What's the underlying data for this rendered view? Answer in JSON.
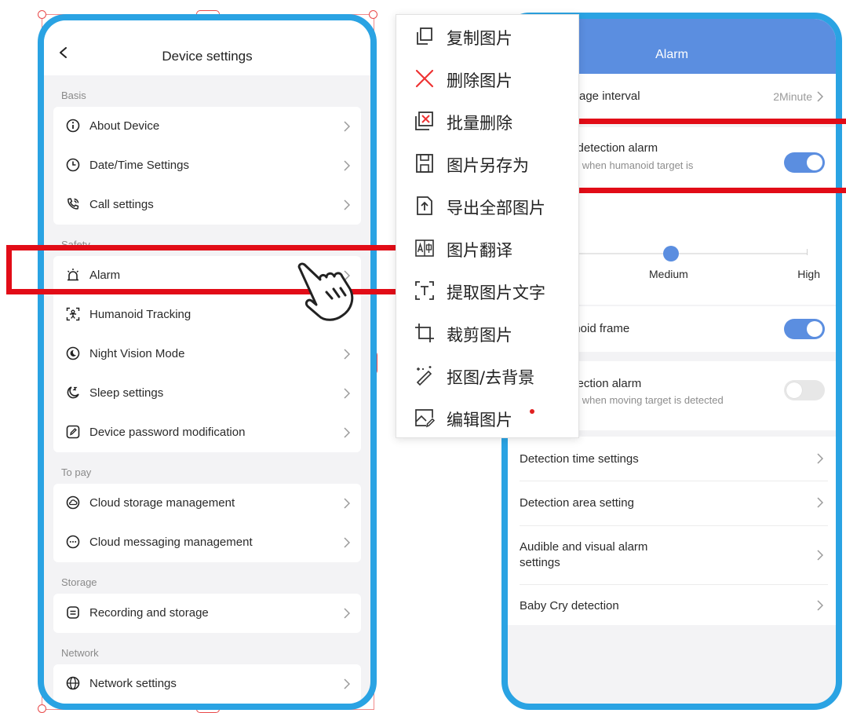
{
  "left_phone": {
    "title": "Device settings",
    "sections": [
      {
        "label": "Basis",
        "items": [
          {
            "label": "About Device",
            "icon": "info-icon"
          },
          {
            "label": "Date/Time Settings",
            "icon": "clock-icon"
          },
          {
            "label": "Call settings",
            "icon": "phone-call-icon"
          }
        ]
      },
      {
        "label": "Safety",
        "items": [
          {
            "label": "Alarm",
            "icon": "alarm-light-icon"
          },
          {
            "label": "Humanoid Tracking",
            "icon": "humanoid-tracking-icon"
          },
          {
            "label": "Night Vision Mode",
            "icon": "night-vision-icon"
          },
          {
            "label": "Sleep settings",
            "icon": "sleep-moon-icon"
          },
          {
            "label": "Device password modification",
            "icon": "password-edit-icon"
          }
        ]
      },
      {
        "label": "To pay",
        "items": [
          {
            "label": "Cloud storage management",
            "icon": "cloud-icon"
          },
          {
            "label": "Cloud messaging management",
            "icon": "message-icon"
          }
        ]
      },
      {
        "label": "Storage",
        "items": [
          {
            "label": "Recording and storage",
            "icon": "storage-icon"
          }
        ]
      },
      {
        "label": "Network",
        "items": [
          {
            "label": "Network settings",
            "icon": "globe-icon"
          }
        ]
      }
    ]
  },
  "right_phone": {
    "title": "Alarm",
    "message_interval": {
      "label": "ssage interval",
      "value": "2Minute"
    },
    "humanoid_alarm": {
      "label": "d detection alarm",
      "sub": "rm when humanoid target is",
      "enabled": true
    },
    "sensitivity": {
      "labels": [
        "Medium",
        "High"
      ],
      "selected": "Medium"
    },
    "humanoid_frame": {
      "label": "anoid frame",
      "enabled": true
    },
    "motion_alarm": {
      "label": "etection alarm",
      "sub": "rm when moving target is detected",
      "enabled": false
    },
    "links": [
      {
        "label": "Detection time settings"
      },
      {
        "label": "Detection area setting"
      },
      {
        "label": "Audible and visual alarm",
        "label2": "settings"
      },
      {
        "label": "Baby Cry detection"
      }
    ]
  },
  "context_menu": {
    "items": [
      {
        "label": "复制图片",
        "icon": "copy-icon"
      },
      {
        "label": "删除图片",
        "icon": "delete-x-icon"
      },
      {
        "label": "批量删除",
        "icon": "batch-delete-icon"
      },
      {
        "label": "图片另存为",
        "icon": "save-as-icon"
      },
      {
        "label": "导出全部图片",
        "icon": "export-icon"
      },
      {
        "label": "图片翻译",
        "icon": "translate-icon"
      },
      {
        "label": "提取图片文字",
        "icon": "extract-text-icon"
      },
      {
        "label": "裁剪图片",
        "icon": "crop-icon"
      },
      {
        "label": "抠图/去背景",
        "icon": "remove-background-icon"
      },
      {
        "label": "编辑图片",
        "icon": "edit-image-icon",
        "badge": true
      }
    ]
  },
  "colors": {
    "phone_border": "#2aa3e3",
    "header_blue": "#5b8ee0",
    "highlight_red": "#e20c17",
    "toggle_on": "#5b8ee0"
  }
}
